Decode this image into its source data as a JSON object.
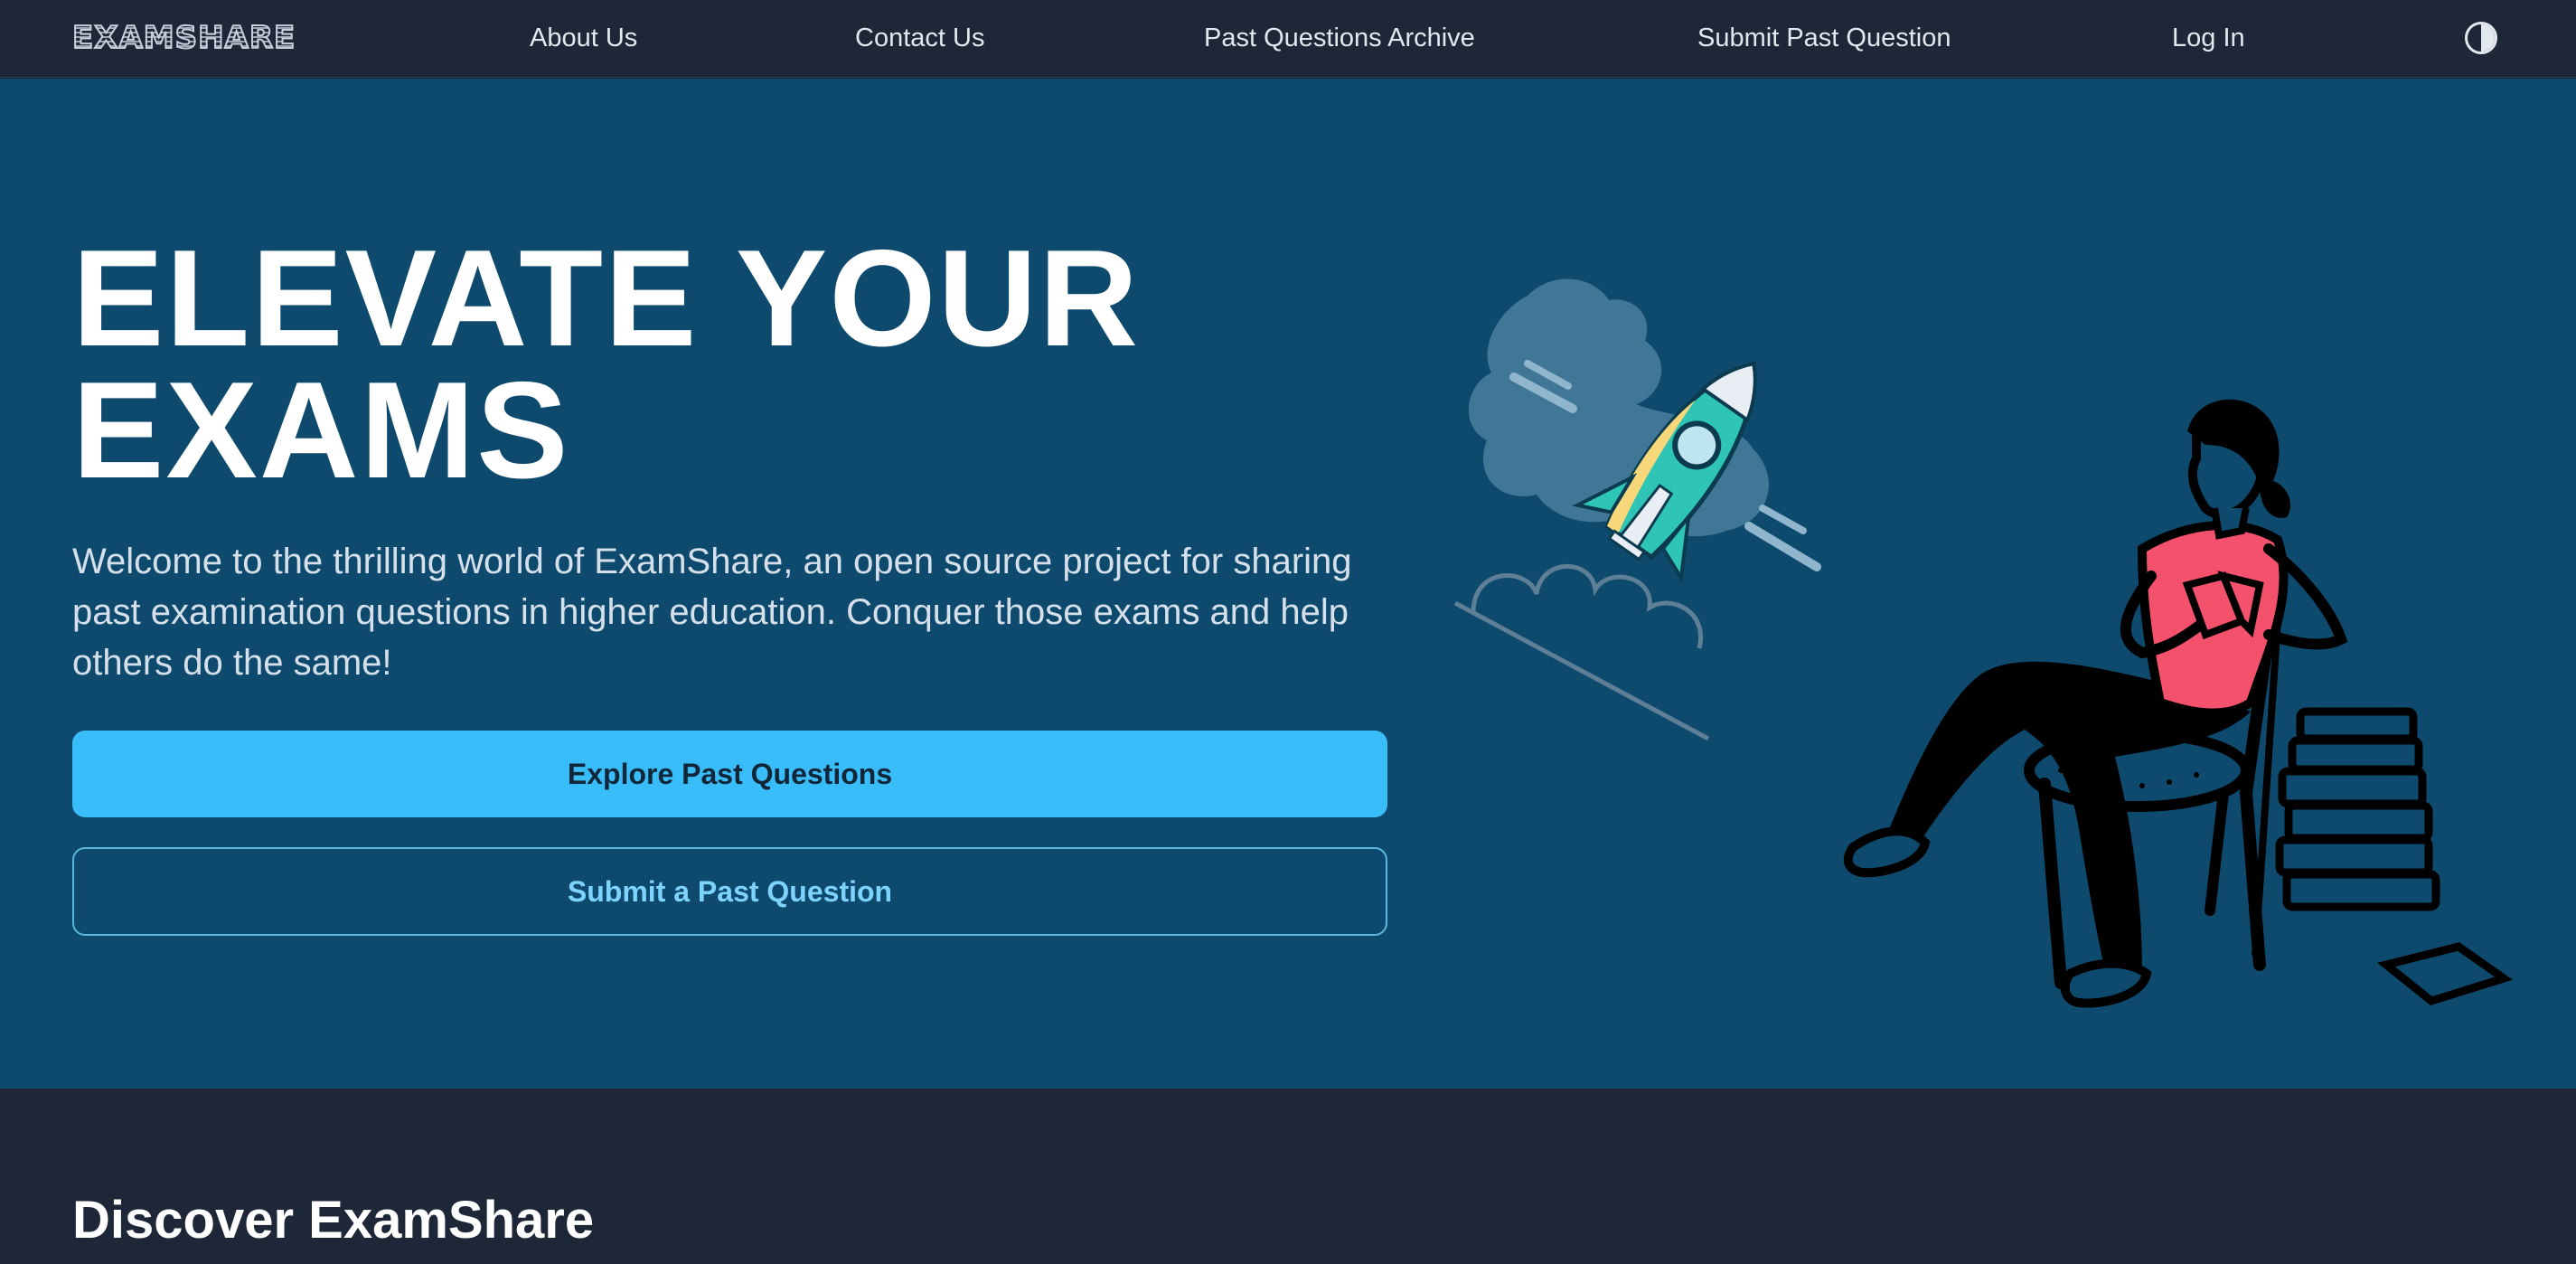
{
  "brand": {
    "logo": "EXAMSHARE"
  },
  "nav": {
    "about": "About Us",
    "contact": "Contact Us",
    "archive": "Past Questions Archive",
    "submit": "Submit Past Question",
    "login": "Log In",
    "theme_icon": "contrast-icon"
  },
  "hero": {
    "title_line1": "ELEVATE YOUR",
    "title_line2": "EXAMS",
    "subtitle": "Welcome to the thrilling world of ExamShare, an open source project for sharing past examination questions in higher education. Conquer those exams and help others do the same!",
    "primary_button": "Explore Past Questions",
    "secondary_button": "Submit a Past Question",
    "illustration_rocket": "rocket-illustration",
    "illustration_person": "reading-person-illustration"
  },
  "discover": {
    "title": "Discover ExamShare"
  },
  "colors": {
    "nav_bg": "#1e2738",
    "hero_bg": "#0d4a6e",
    "accent": "#38bdf8",
    "accent_text": "#7dd3fc",
    "shirt": "#f4516c",
    "rocket": "#2ec4b6"
  }
}
